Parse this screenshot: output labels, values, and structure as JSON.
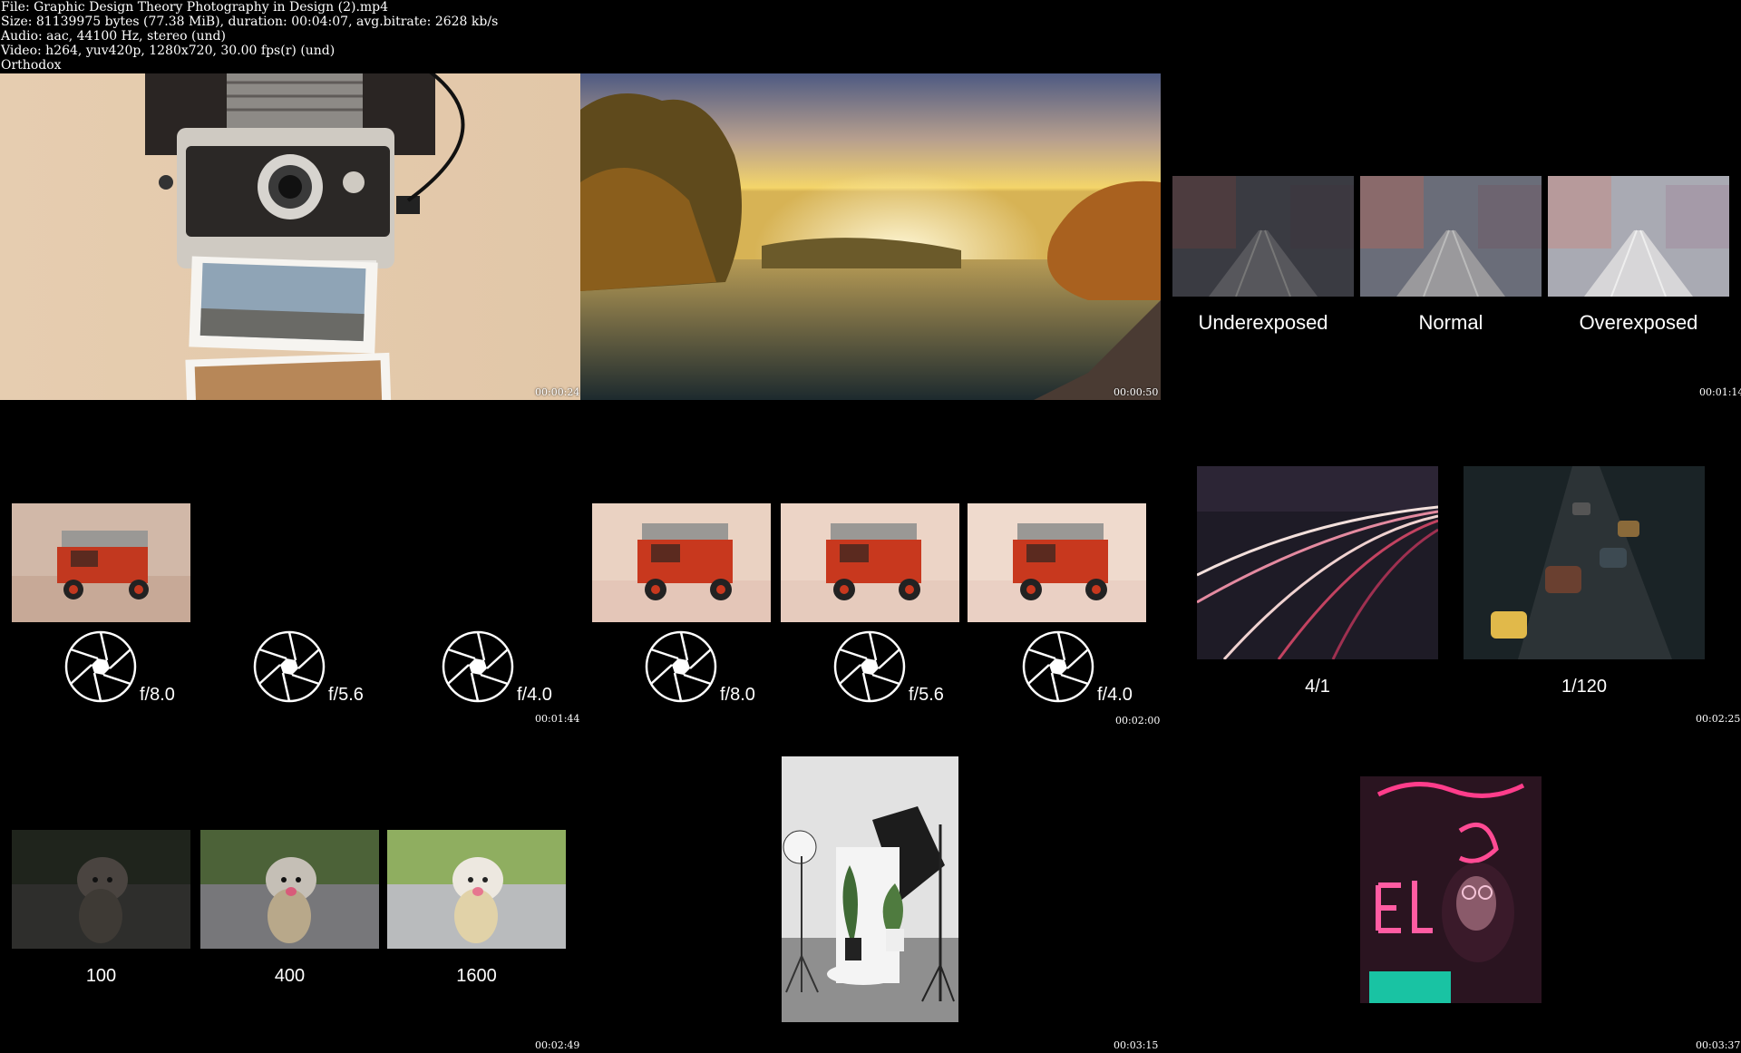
{
  "header": {
    "line1": "File: Graphic Design Theory  Photography in Design (2).mp4",
    "line2": "Size: 81139975 bytes (77.38 MiB), duration: 00:04:07, avg.bitrate: 2628 kb/s",
    "line3": "Audio: aac, 44100 Hz, stereo (und)",
    "line4": "Video: h264, yuv420p, 1280x720, 30.00 fps(r) (und)",
    "line5": "Orthodox"
  },
  "thumbnails": [
    {
      "timestamp": "00:00:24"
    },
    {
      "timestamp": "00:00:50"
    },
    {
      "timestamp": "00:01:14",
      "labels": [
        "Underexposed",
        "Normal",
        "Overexposed"
      ]
    },
    {
      "timestamp": "00:01:44",
      "apertures": [
        "f/8.0",
        "f/5.6",
        "f/4.0"
      ]
    },
    {
      "timestamp": "00:02:00",
      "apertures": [
        "f/8.0",
        "f/5.6",
        "f/4.0"
      ]
    },
    {
      "timestamp": "00:02:25",
      "labels": [
        "4/1",
        "1/120"
      ]
    },
    {
      "timestamp": "00:02:49",
      "labels": [
        "100",
        "400",
        "1600"
      ]
    },
    {
      "timestamp": "00:03:15"
    },
    {
      "timestamp": "00:03:37"
    }
  ]
}
